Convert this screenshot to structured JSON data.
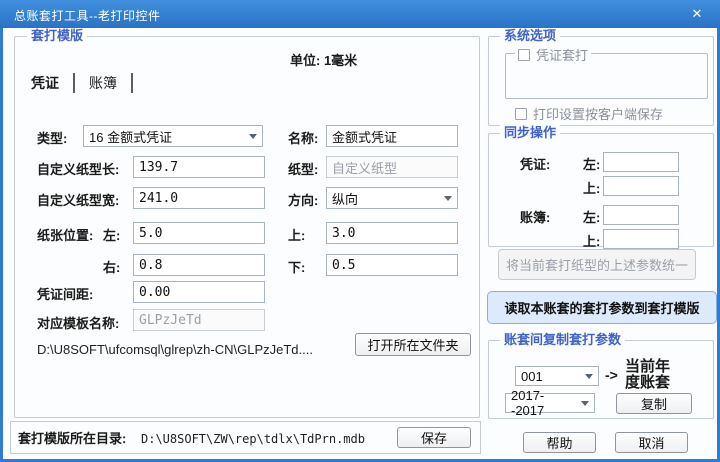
{
  "window": {
    "title": "总账套打工具--老打印控件",
    "close_glyph": "✕"
  },
  "left": {
    "group_title": "套打模版",
    "unit_text": "单位: 1毫米",
    "tabs": [
      {
        "label": "凭证"
      },
      {
        "label": "账簿"
      }
    ],
    "rows": {
      "type_label": "类型:",
      "type_value": "16 金额式凭证",
      "name_label": "名称:",
      "name_value": "金额式凭证",
      "length_label": "自定义纸型长:",
      "length_value": "139.7",
      "papertype_label": "纸型:",
      "papertype_value": "自定义纸型",
      "width_label": "自定义纸型宽:",
      "width_value": "241.0",
      "orient_label": "方向:",
      "orient_value": "纵向",
      "pos_label": "纸张位置:",
      "pos_left_label": "左:",
      "pos_left_value": "5.0",
      "pos_top_label": "上:",
      "pos_top_value": "3.0",
      "pos_right_label": "右:",
      "pos_right_value": "0.8",
      "pos_bottom_label": "下:",
      "pos_bottom_value": "0.5",
      "gap_label": "凭证间距:",
      "gap_value": "0.00",
      "tplname_label": "对应模板名称:",
      "tplname_value": "GLPzJeTd"
    },
    "file_path": "D:\\U8SOFT\\ufcomsql\\glrep\\zh-CN\\GLPzJeTd....",
    "open_folder_button": "打开所在文件夹",
    "dir_label": "套打模版所在目录:",
    "dir_value": "D:\\U8SOFT\\ZW\\rep\\tdlx\\TdPrn.mdb",
    "save_button": "保存"
  },
  "right": {
    "system": {
      "title": "系统选项",
      "voucher_option": "凭证套打",
      "client_option": "打印设置按客户端保存"
    },
    "sync": {
      "title": "同步操作",
      "voucher_label": "凭证:",
      "book_label": "账簿:",
      "left_label": "左:",
      "top_label": "上:"
    },
    "unify_button": "将当前套打纸型的上述参数统一",
    "read_button": "读取本账套的套打参数到套打模版",
    "copy": {
      "title": "账套间复制套打参数",
      "source_account": "001",
      "arrow": "->",
      "target_text": "当前年度账套",
      "year_range": "2017--2017",
      "copy_button": "复制"
    },
    "help_button": "帮助",
    "cancel_button": "取消"
  }
}
